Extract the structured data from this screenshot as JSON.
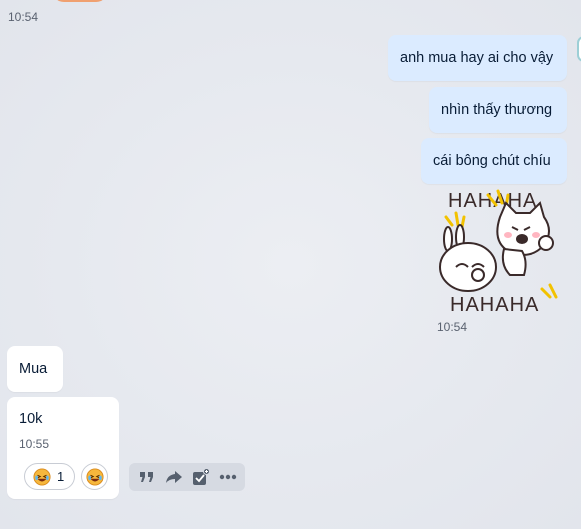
{
  "conversation": {
    "time_top": "10:54",
    "outgoing_messages": [
      {
        "text": "anh mua hay ai cho vậy"
      },
      {
        "text": "nhìn thấy thương"
      },
      {
        "text": "cái bông chút chíu"
      }
    ],
    "sticker": {
      "top_text": "HAHAHA",
      "bottom_text": "HAHAHA",
      "time": "10:54",
      "icon": "laughing-cat-bunny-sticker"
    },
    "incoming_messages": [
      {
        "text": "Mua"
      },
      {
        "text": "10k",
        "time": "10:55"
      }
    ],
    "reaction": {
      "icon": "laughing-emoji",
      "count": "1"
    }
  },
  "action_bar": {
    "items": [
      "quote-icon",
      "forward-icon",
      "task-icon",
      "more-icon"
    ]
  },
  "colors": {
    "background": "#e4e7ee",
    "outgoing_bubble": "#dbebff",
    "incoming_bubble": "#ffffff",
    "text": "#081c36"
  }
}
